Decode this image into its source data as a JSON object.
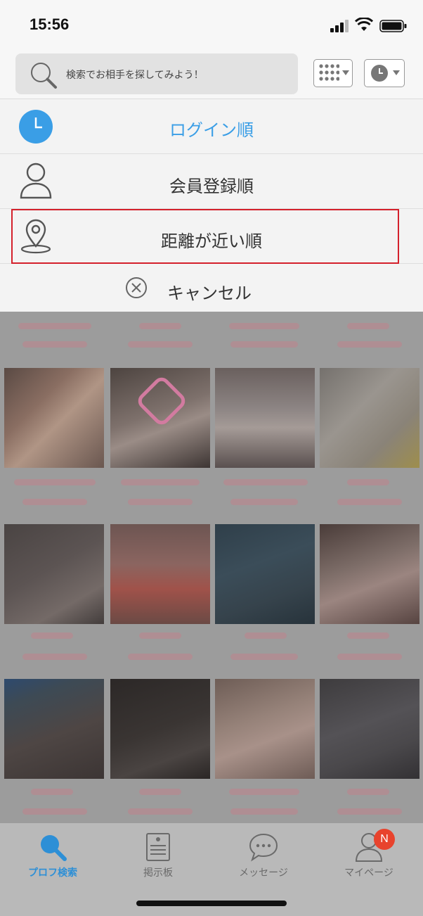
{
  "status_bar": {
    "time": "15:56"
  },
  "search": {
    "placeholder": "検索でお相手を探してみよう！"
  },
  "sort_menu": {
    "items": [
      {
        "label": "ログイン順",
        "icon": "clock-icon",
        "selected": true
      },
      {
        "label": "会員登録順",
        "icon": "person-icon",
        "selected": false
      },
      {
        "label": "距離が近い順",
        "icon": "location-pin-icon",
        "selected": false,
        "highlighted": true
      }
    ],
    "cancel_label": "キャンセル"
  },
  "tab_bar": {
    "tabs": [
      {
        "label": "プロフ検索",
        "icon": "search-icon",
        "active": true
      },
      {
        "label": "掲示板",
        "icon": "board-icon",
        "active": false
      },
      {
        "label": "メッセージ",
        "icon": "chat-icon",
        "active": false
      },
      {
        "label": "マイページ",
        "icon": "person-icon",
        "active": false,
        "badge": "N"
      }
    ]
  },
  "colors": {
    "accent": "#3a9ee6",
    "highlight_border": "#d4202b",
    "badge": "#e8432d"
  }
}
